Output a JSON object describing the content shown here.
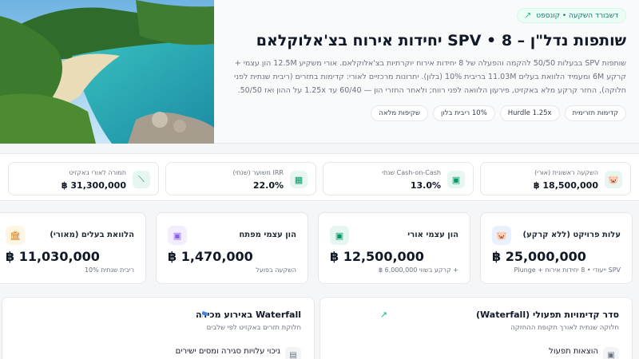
{
  "hero": {
    "tag": "דשבורד השקעה • קונספט",
    "title": "שותפות נדל\"ן – SPV • 8 יחידות אירוח בצ'אלוקלאם",
    "description": "שותפות SPV בבעלות 50/50 להקמה והפעלה של 8 יחידות אירוח יוקרתיות בצ'אלוקלאם. אורי משקיע 12.5M הון עצמי + קרקע 6M ומעמיד הלוואת בעלים 11.03M בריבית 10% (בלון). יתרונות מרכזיים לאורי: קדימות בתזרים (ריבית שנתית לפני חלוקה), החזר קרקע מלא באקזיט, פירעון הלוואה לפני רווח; ולאחר החזרי הון — 60/40 עד 1.25x על ההון ואז 50/50.",
    "chips": [
      "קדימות תזרימית",
      "Hurdle 1.25x",
      "10% ריבית בלון",
      "שקיפות מלאה"
    ]
  },
  "metrics": [
    {
      "label": "השקעה ראשונית (אורי)",
      "value": "18,500,000 ฿",
      "icon": "piggy-bank-icon"
    },
    {
      "label": "Cash-on-Cash שנתי",
      "value": "13.0%",
      "icon": "wallet-icon"
    },
    {
      "label": "IRR משוער (שנתי)",
      "value": "22.0%",
      "icon": "calculator-icon"
    },
    {
      "label": "תמורה לאורי באקזיט",
      "value": "31,300,000 ฿",
      "icon": "trend-chart-icon"
    }
  ],
  "cards": [
    {
      "label": "עלות פרויקט (ללא קרקע)",
      "value": "฿ 25,000,000",
      "sub": "SPV ייעודי • 8 יחידות אירוח + Plunge",
      "icon": "piggy-bank-icon"
    },
    {
      "label": "הון עצמי אורי",
      "value": "฿ 12,500,000",
      "sub": "+ קרקע בשווי 6,000,000 ฿",
      "icon": "wallet-icon"
    },
    {
      "label": "הון עצמי מפתח",
      "value": "฿ 1,470,000",
      "sub": "השקעה בפועל",
      "icon": "wallet-icon"
    },
    {
      "label": "הלוואת בעלים (מאורי)",
      "value": "฿ 11,030,000",
      "sub": "ריבית שנתית 10%",
      "icon": "bank-icon"
    }
  ],
  "panels": {
    "priority": {
      "title": "סדר קדימויות תפעולי (Waterfall)",
      "subtitle": "חלוקה שנתית לאורך תקופת ההחזקה",
      "row": "הוצאות תפעול"
    },
    "exit": {
      "title": "Waterfall באירוע מכירה",
      "subtitle": "חלוקת תזרים באקזיט לפי שלבים",
      "row": "ניכוי עלויות סגירה ומסים ישירים"
    }
  },
  "colors": {
    "accent": "#10b981",
    "blue": "#3b82f6",
    "purple": "#8b5cf6",
    "amber": "#f59e0b"
  }
}
